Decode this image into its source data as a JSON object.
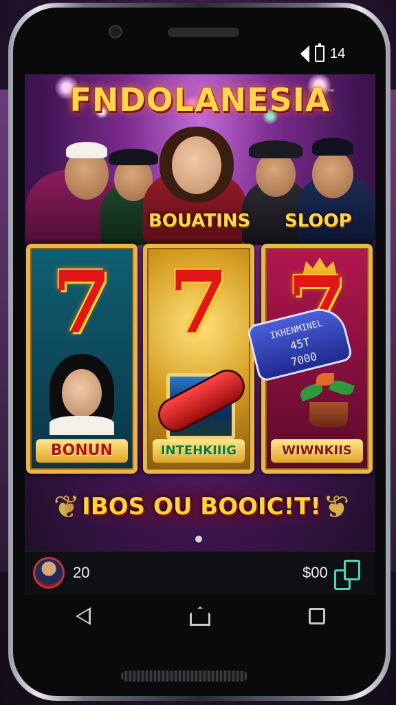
{
  "status_bar": {
    "time": "14"
  },
  "game": {
    "title": "FNDOLANESIA",
    "trademark": "™",
    "host_labels": [
      "BOUATINS",
      "SLOOP"
    ],
    "reels": [
      {
        "symbol": "7",
        "label": "BONUN"
      },
      {
        "symbol": "7",
        "label": "INTEHKIIIG"
      },
      {
        "symbol": "7",
        "label": "WIWNKIIS"
      }
    ],
    "tag": {
      "line1": "IKHENMINEL",
      "line2": "45T",
      "line3": "7000"
    },
    "banner": "IBOS OU BOOIC!T!",
    "page_indicator": "1"
  },
  "footer_bar": {
    "coins": "20",
    "bank": "$00"
  },
  "nav": [
    "back",
    "home",
    "recent"
  ],
  "colors": {
    "gold": "#ffd54a",
    "reel_teal": "#0f5f72",
    "reel_gold": "#d39a1f",
    "reel_crimson": "#b3164e",
    "accent_cards": "#4fd6b5"
  }
}
